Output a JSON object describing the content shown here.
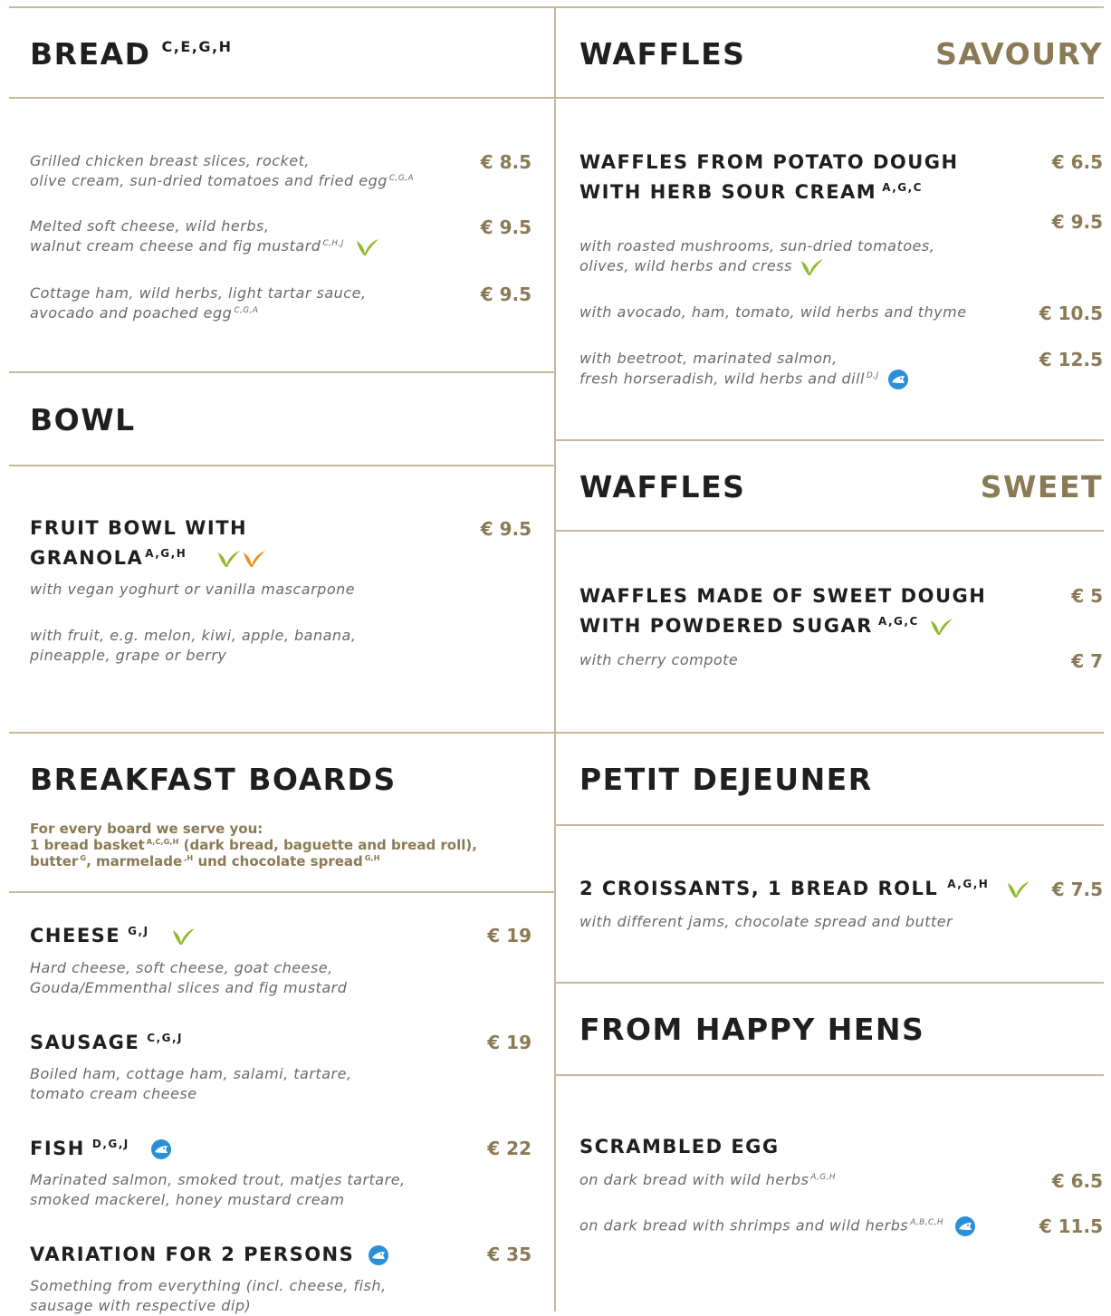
{
  "bread": {
    "title": "BREAD",
    "allergens": "C,E,G,H",
    "items": [
      {
        "line1": "Grilled chicken breast slices, rocket,",
        "line2": "olive cream, sun-dried tomatoes and fried egg",
        "allergens": "C,G,A",
        "price": "€ 8.5"
      },
      {
        "line1": "Melted soft cheese, wild herbs,",
        "line2": "walnut cream cheese and fig mustard",
        "allergens": "C,H,J",
        "price": "€ 9.5"
      },
      {
        "line1": "Cottage ham, wild herbs, light tartar sauce,",
        "line2": "avocado and poached egg",
        "allergens": "C,G,A",
        "price": "€ 9.5"
      }
    ]
  },
  "bowl": {
    "title": "BOWL",
    "item_line1": "FRUIT BOWL WITH",
    "item_line2": "GRANOLA",
    "item_allergens": "A,G,H",
    "price": "€ 9.5",
    "desc1": "with vegan yoghurt or vanilla mascarpone",
    "desc2_line1": "with fruit, e.g. melon, kiwi, apple, banana,",
    "desc2_line2": "pineapple, grape or berry"
  },
  "boards": {
    "title": "BREAKFAST BOARDS",
    "note_line1": "For every board we serve you:",
    "note_line2a": "1 bread basket",
    "note_sup1": "A,C,G,H",
    "note_line2b": "(dark bread, baguette and bread roll),",
    "note_line3a": "butter",
    "note_sup2": "G",
    "note_line3b": ", marmelade",
    "note_sup3": ",H",
    "note_line3c": "und chocolate spread",
    "note_sup4": "G,H",
    "items": [
      {
        "name": "CHEESE",
        "allergens": "G,J",
        "price": "€ 19",
        "line1": "Hard cheese, soft cheese, goat cheese,",
        "line2": "Gouda/Emmenthal slices and fig mustard"
      },
      {
        "name": "SAUSAGE",
        "allergens": "C,G,J",
        "price": "€ 19",
        "line1": "Boiled ham, cottage ham, salami, tartare,",
        "line2": "tomato cream cheese"
      },
      {
        "name": "FISH",
        "allergens": "D,G,J",
        "price": "€ 22",
        "line1": "Marinated salmon, smoked trout, matjes tartare,",
        "line2": "smoked mackerel, honey mustard cream"
      },
      {
        "name": "VARIATION FOR 2 PERSONS",
        "allergens": "",
        "price": "€ 35",
        "line1": "Something from everything (incl. cheese, fish,",
        "line2": "sausage with respective dip)"
      }
    ]
  },
  "waffles_savoury": {
    "title": "WAFFLES",
    "subtitle": "SAVOURY",
    "item_line1": "WAFFLES FROM POTATO DOUGH",
    "item_line2": "WITH HERB SOUR CREAM",
    "item_allergens": "A,G,C",
    "item_price": "€ 6.5",
    "options": [
      {
        "line1": "with roasted mushrooms, sun-dried tomatoes,",
        "line2": "olives, wild herbs and cress",
        "allergens": "",
        "price": "€ 9.5"
      },
      {
        "line1": "with avocado, ham, tomato, wild herbs and thyme",
        "line2": "",
        "allergens": "",
        "price": "€ 10.5"
      },
      {
        "line1": "with beetroot, marinated salmon,",
        "line2": "fresh horseradish, wild herbs and dill",
        "allergens": "D,J",
        "price": "€ 12.5"
      }
    ]
  },
  "waffles_sweet": {
    "title": "WAFFLES",
    "subtitle": "SWEET",
    "item_line1": "WAFFLES MADE OF SWEET DOUGH",
    "item_line2": "WITH POWDERED SUGAR",
    "item_allergens": "A,G,C",
    "item_price": "€ 5",
    "option": "with cherry compote",
    "option_price": "€ 7"
  },
  "petit": {
    "title": "PETIT DEJEUNER",
    "item": "2 CROISSANTS, 1 BREAD ROLL",
    "item_allergens": "A,G,H",
    "price": "€ 7.5",
    "desc": "with different jams, chocolate spread and butter"
  },
  "hens": {
    "title": "FROM HAPPY HENS",
    "item": "SCRAMBLED EGG",
    "options": [
      {
        "text": "on dark bread with wild herbs",
        "allergens": "A,G,H",
        "price": "€ 6.5"
      },
      {
        "text": "on dark bread with shrimps and wild herbs",
        "allergens": "A,B,C,H",
        "price": "€ 11.5"
      }
    ]
  },
  "icons": {
    "vegetarian": "leaf-icon",
    "vegan": "leaf-icon",
    "fish": "fish-icon"
  },
  "colors": {
    "accent": "#8a7a55",
    "rule": "#c7b89b",
    "leaf_green": "#8dba2e",
    "leaf_orange": "#f0901e",
    "fish_blue": "#2a8fd9"
  }
}
